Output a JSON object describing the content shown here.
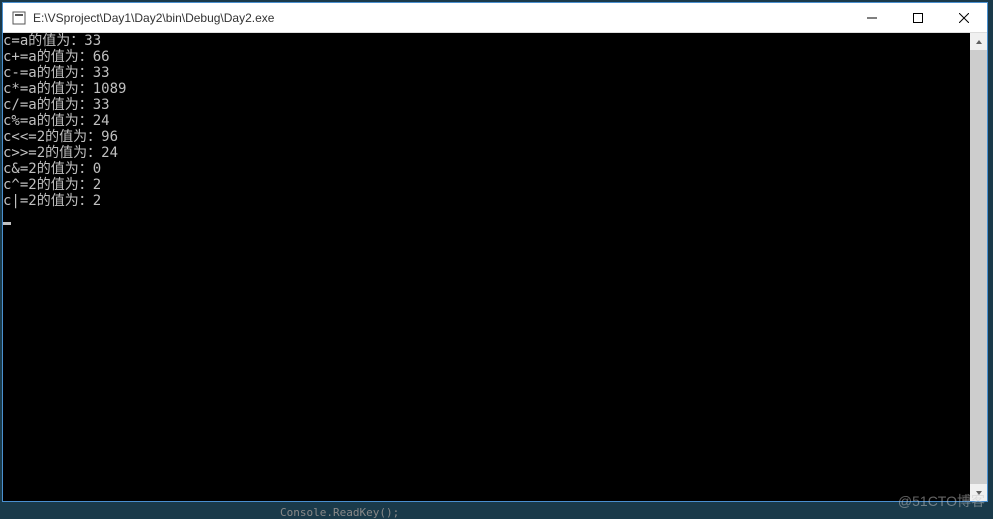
{
  "window": {
    "title": "E:\\VSproject\\Day1\\Day2\\bin\\Debug\\Day2.exe"
  },
  "console": {
    "lines": [
      "c=a的值为：33",
      "c+=a的值为：66",
      "c-=a的值为：33",
      "c*=a的值为：1089",
      "c/=a的值为：33",
      "c%=a的值为：24",
      "c<<=2的值为：96",
      "c>>=2的值为：24",
      "c&=2的值为：0",
      "c^=2的值为：2",
      "c|=2的值为：2"
    ]
  },
  "watermark": "@51CTO博客",
  "bottom_snippet": "Console.ReadKey();"
}
